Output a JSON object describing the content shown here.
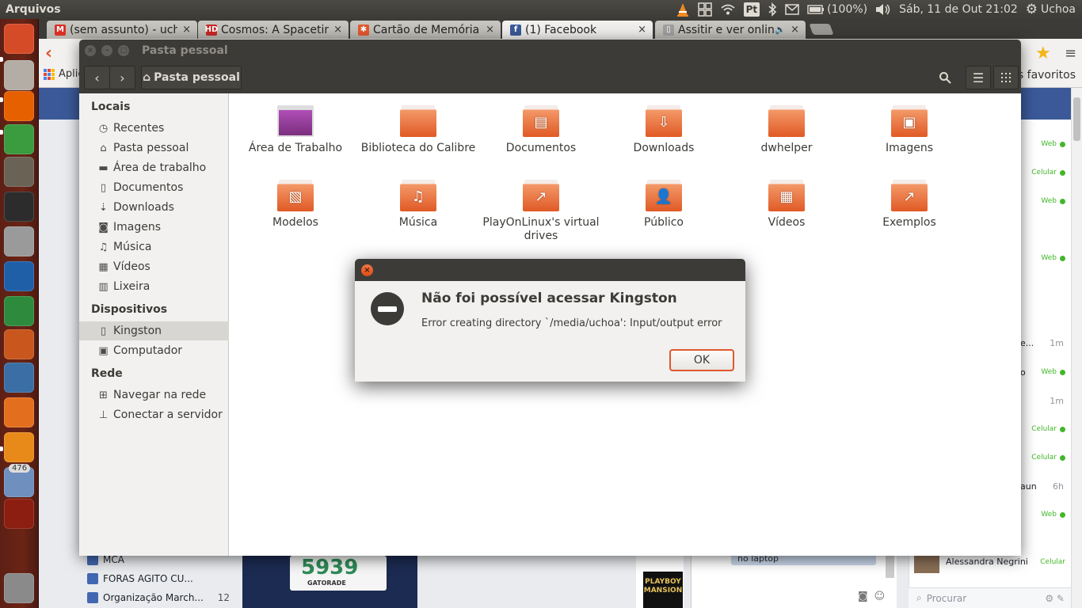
{
  "top_panel": {
    "app_name": "Arquivos",
    "keyboard_layout": "Pt",
    "battery": "(100%)",
    "datetime": "Sáb, 11 de Out 21:02",
    "user": "Uchoa"
  },
  "launcher": {
    "items": [
      {
        "name": "dash-home",
        "color": "#d64b27"
      },
      {
        "name": "files",
        "color": "#b3ada6"
      },
      {
        "name": "firefox",
        "color": "#e66000"
      },
      {
        "name": "chrome",
        "color": "#3a9b3f"
      },
      {
        "name": "gimp",
        "color": "#6b6256"
      },
      {
        "name": "inkscape",
        "color": "#2c2c2c"
      },
      {
        "name": "installer",
        "color": "#9a9a9a"
      },
      {
        "name": "writer",
        "color": "#1f5fa8"
      },
      {
        "name": "calc",
        "color": "#2e8b3e"
      },
      {
        "name": "impress",
        "color": "#c8561d"
      },
      {
        "name": "system-monitor",
        "color": "#3a6ea5"
      },
      {
        "name": "software-center",
        "color": "#e36f1e"
      },
      {
        "name": "vlc",
        "color": "#e88a1a"
      },
      {
        "name": "updates",
        "color": "#6f8fbf",
        "badge": "476"
      },
      {
        "name": "usb-drive",
        "color": "#8b1e10"
      },
      {
        "name": "trash",
        "color": "#8a8a8a"
      }
    ]
  },
  "browser": {
    "tabs": [
      {
        "title": "(sem assunto) - uchoa",
        "favicon": "gmail-icon",
        "favicon_text": "M",
        "favicon_color": "#d93025",
        "active": false
      },
      {
        "title": "Cosmos: A Spacetime",
        "favicon": "hd-icon",
        "favicon_text": "HD",
        "favicon_color": "#c62828",
        "active": false
      },
      {
        "title": "Cartão de Memória Sa",
        "favicon": "site-icon",
        "favicon_text": "✱",
        "favicon_color": "#e0582e",
        "active": false
      },
      {
        "title": "(1) Facebook",
        "favicon": "facebook-icon",
        "favicon_text": "f",
        "favicon_color": "#3b5998",
        "active": true
      },
      {
        "title": "Assitir e ver online",
        "favicon": "page-icon",
        "favicon_text": "▯",
        "favicon_color": "#9e9e9e",
        "active": false,
        "audio": true
      }
    ],
    "bookmarks_apps": "Aplic",
    "other_bookmarks": "os favoritos"
  },
  "facebook": {
    "left_items": [
      {
        "label": "MCA",
        "count": ""
      },
      {
        "label": "FORAS AGITO CU...",
        "count": ""
      },
      {
        "label": "Organização March...",
        "count": "12"
      }
    ],
    "bib_number": "5939",
    "bib_brand": "GATORADE",
    "chat_thumb_text": "PLAYBOY MANSION",
    "message_bubble": "no laptop",
    "sidebar_rows": [
      {
        "type": "status",
        "text": "Web"
      },
      {
        "type": "status",
        "text": "Celular"
      },
      {
        "type": "status",
        "text": "Web"
      },
      {
        "type": "status",
        "text": "Web"
      },
      {
        "type": "time",
        "name": "e...",
        "text": "1m"
      },
      {
        "type": "status",
        "name": "o",
        "text": "Web"
      },
      {
        "type": "time",
        "text": "1m"
      },
      {
        "type": "status",
        "text": "Celular"
      },
      {
        "type": "status",
        "text": "Celular"
      },
      {
        "type": "time",
        "name": "aun",
        "text": "6h"
      },
      {
        "type": "status",
        "text": "Web"
      }
    ],
    "named_contact": {
      "name": "Alessandra Negrini",
      "status": "Celular"
    },
    "chat_search_placeholder": "Procurar"
  },
  "nautilus": {
    "window_title": "Pasta pessoal",
    "path_button": "Pasta pessoal",
    "sidebar": {
      "sections": [
        {
          "heading": "Locais",
          "items": [
            {
              "label": "Recentes",
              "icon": "clock-icon",
              "glyph": "◷"
            },
            {
              "label": "Pasta pessoal",
              "icon": "home-icon",
              "glyph": "⌂"
            },
            {
              "label": "Área de trabalho",
              "icon": "desktop-folder-icon",
              "glyph": "▬"
            },
            {
              "label": "Documentos",
              "icon": "document-icon",
              "glyph": "▯"
            },
            {
              "label": "Downloads",
              "icon": "download-icon",
              "glyph": "⇣"
            },
            {
              "label": "Imagens",
              "icon": "camera-icon",
              "glyph": "◙"
            },
            {
              "label": "Música",
              "icon": "music-icon",
              "glyph": "♫"
            },
            {
              "label": "Vídeos",
              "icon": "film-icon",
              "glyph": "▦"
            },
            {
              "label": "Lixeira",
              "icon": "trash-icon",
              "glyph": "▥"
            }
          ]
        },
        {
          "heading": "Dispositivos",
          "items": [
            {
              "label": "Kingston",
              "icon": "usb-drive-icon",
              "glyph": "▯",
              "active": true
            },
            {
              "label": "Computador",
              "icon": "computer-icon",
              "glyph": "▣"
            }
          ]
        },
        {
          "heading": "Rede",
          "items": [
            {
              "label": "Navegar na rede",
              "icon": "network-icon",
              "glyph": "⊞"
            },
            {
              "label": "Conectar a servidor",
              "icon": "server-icon",
              "glyph": "⊥"
            }
          ]
        }
      ]
    },
    "folders": [
      {
        "label": "Área de Trabalho",
        "emblem": "desktop"
      },
      {
        "label": "Biblioteca do Calibre",
        "emblem": ""
      },
      {
        "label": "Documentos",
        "emblem": "▤"
      },
      {
        "label": "Downloads",
        "emblem": "⇩"
      },
      {
        "label": "dwhelper",
        "emblem": ""
      },
      {
        "label": "Imagens",
        "emblem": "▣"
      },
      {
        "label": "Modelos",
        "emblem": "▧"
      },
      {
        "label": "Música",
        "emblem": "♫"
      },
      {
        "label": "PlayOnLinux's virtual drives",
        "emblem": "↗"
      },
      {
        "label": "Público",
        "emblem": "👤"
      },
      {
        "label": "Vídeos",
        "emblem": "▦"
      },
      {
        "label": "Exemplos",
        "emblem": "↗"
      }
    ]
  },
  "dialog": {
    "heading": "Não foi possível acessar Kingston",
    "message": "Error creating directory `/media/uchoa': Input/output error",
    "ok_label": "OK"
  }
}
